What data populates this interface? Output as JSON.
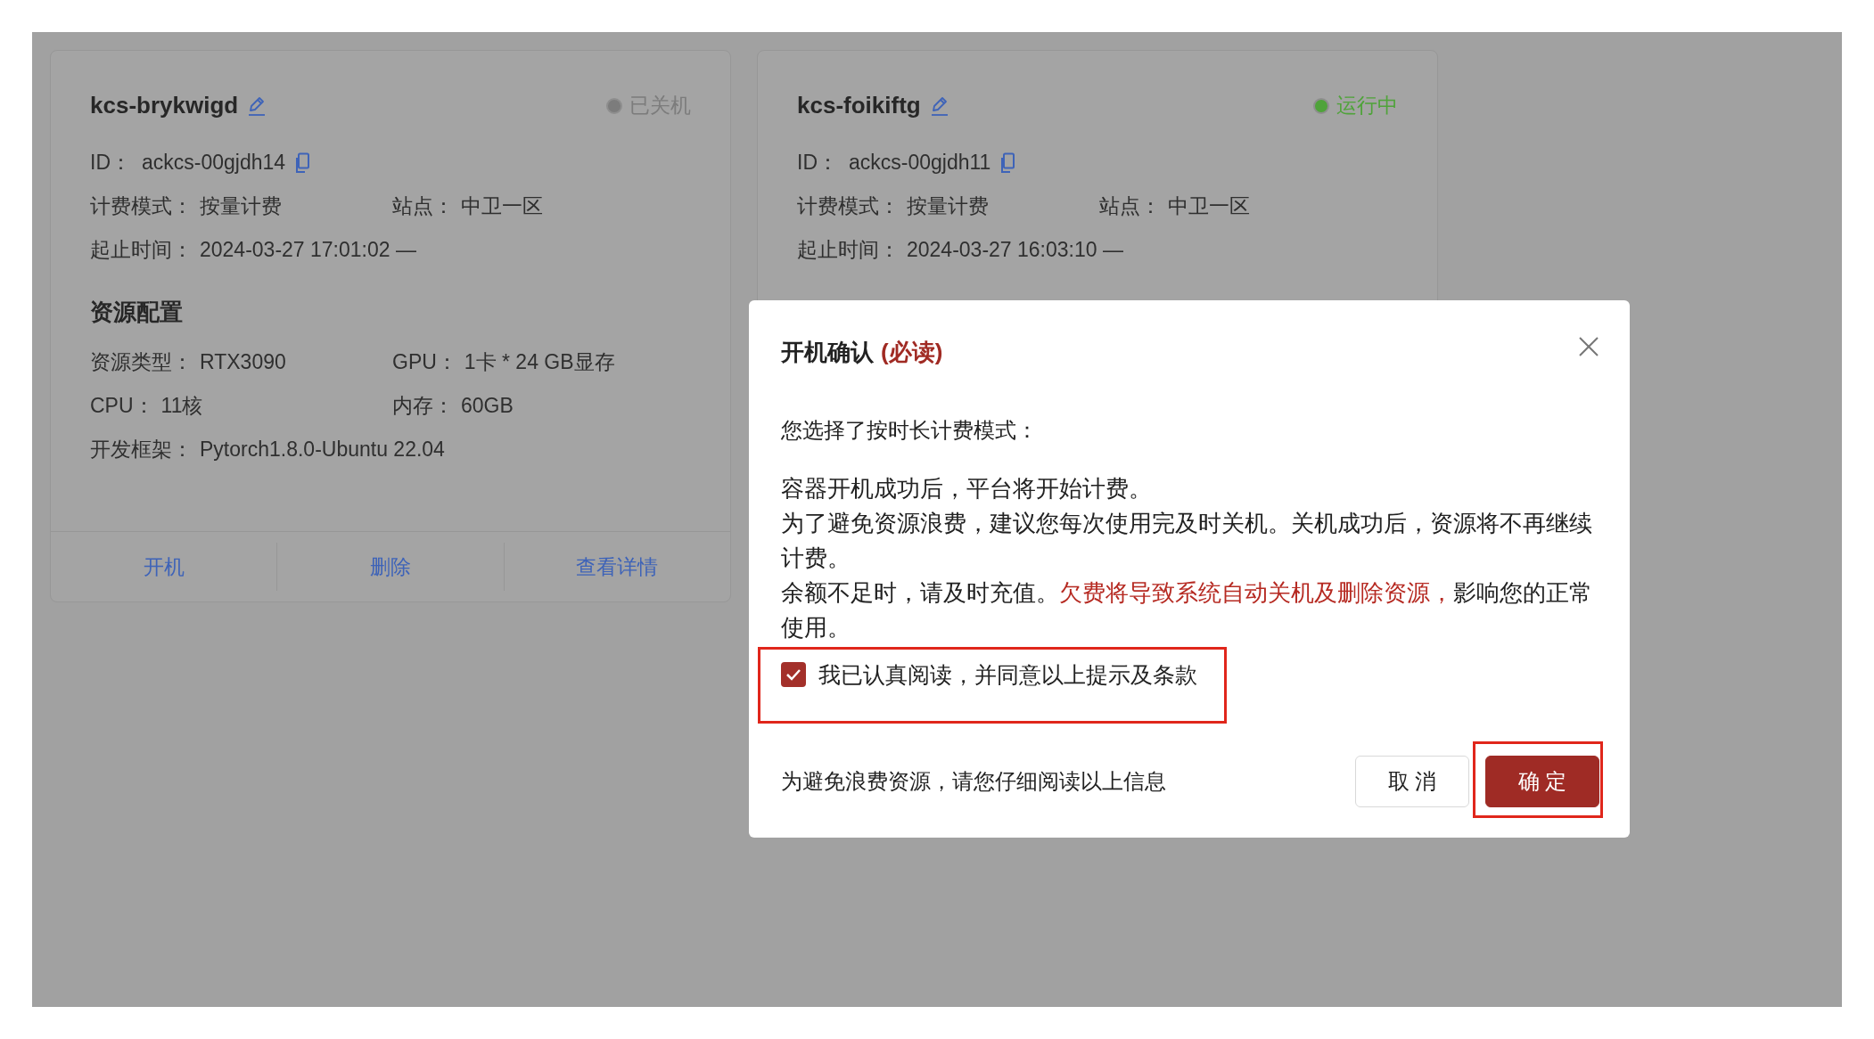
{
  "cards": [
    {
      "name": "kcs-brykwigd",
      "status": {
        "label": "已关机",
        "color": "#7c7c7c"
      },
      "id_label": "ID：",
      "id": "ackcs-00gjdh14",
      "fields": [
        [
          {
            "label": "计费模式：",
            "value": "按量计费"
          },
          {
            "label": "站点：",
            "value": "中卫一区"
          }
        ],
        [
          {
            "label": "起止时间：",
            "value": "2024-03-27 17:01:02 —"
          }
        ]
      ],
      "resource_title": "资源配置",
      "resources": [
        [
          {
            "label": "资源类型：",
            "value": "RTX3090"
          },
          {
            "label": "GPU：",
            "value": "1卡 * 24 GB显存"
          }
        ],
        [
          {
            "label": "CPU：",
            "value": "11核"
          },
          {
            "label": "内存：",
            "value": "60GB"
          }
        ],
        [
          {
            "label": "开发框架：",
            "value": "Pytorch1.8.0-Ubuntu 22.04"
          }
        ]
      ],
      "actions": [
        "开机",
        "删除",
        "查看详情"
      ]
    },
    {
      "name": "kcs-foikiftg",
      "status": {
        "label": "运行中",
        "color": "#4fa33a"
      },
      "id_label": "ID：",
      "id": "ackcs-00gjdh11",
      "fields": [
        [
          {
            "label": "计费模式：",
            "value": "按量计费"
          },
          {
            "label": "站点：",
            "value": "中卫一区"
          }
        ],
        [
          {
            "label": "起止时间：",
            "value": "2024-03-27 16:03:10 —"
          }
        ]
      ]
    }
  ],
  "dialog": {
    "title": "开机确认",
    "title_tag": "(必读)",
    "intro": "您选择了按时长计费模式：",
    "paragraphs": [
      [
        {
          "text": "容器开机成功后，平台将开始计费。",
          "warning": false
        }
      ],
      [
        {
          "text": "为了避免资源浪费，建议您每次使用完及时关机。关机成功后，资源将不再继续计费。",
          "warning": false
        }
      ],
      [
        {
          "text": "余额不足时，请及时充值。",
          "warning": false
        },
        {
          "text": "欠费将导致系统自动关机及删除资源，",
          "warning": true
        },
        {
          "text": "影响您的正常使用。",
          "warning": false
        }
      ]
    ],
    "agreement": {
      "label": "我已认真阅读，并同意以上提示及条款",
      "checked": true,
      "highlighted": true
    },
    "footer_note": "为避免浪费资源，请您仔细阅读以上信息",
    "buttons": [
      {
        "label": "取 消",
        "kind": "default",
        "highlighted": false
      },
      {
        "label": "确 定",
        "kind": "primary",
        "highlighted": true
      }
    ]
  }
}
